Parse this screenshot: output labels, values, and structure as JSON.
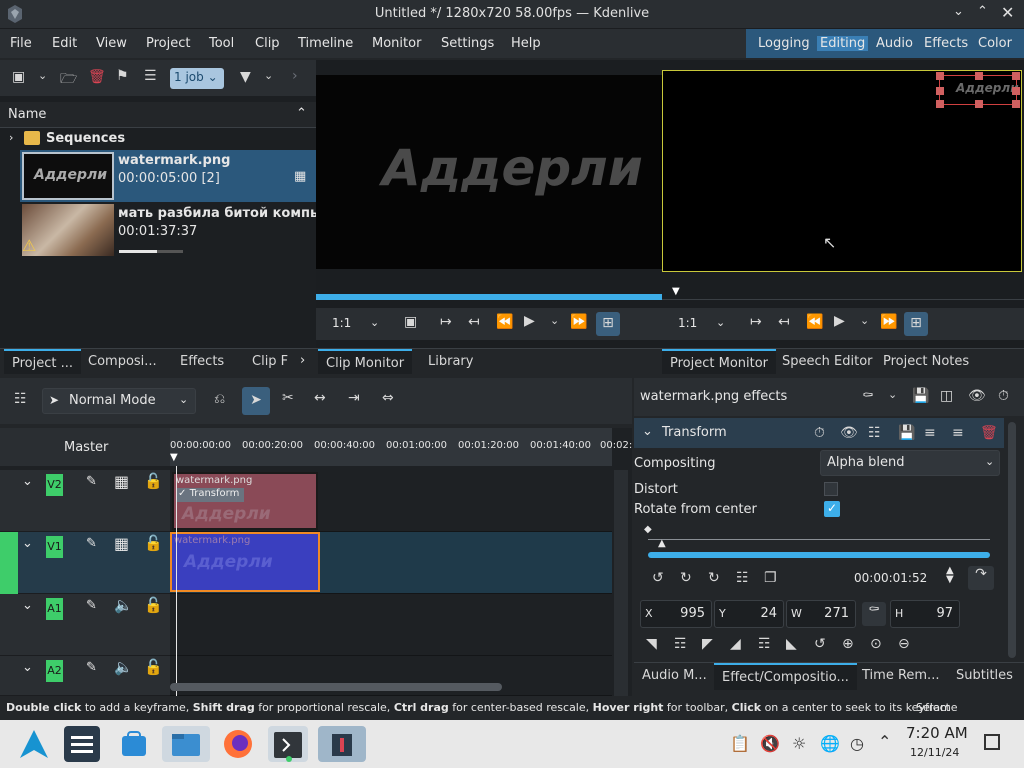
{
  "window": {
    "title": "Untitled */ 1280x720 58.00fps — Kdenlive"
  },
  "menu": {
    "items": [
      "File",
      "Edit",
      "View",
      "Project",
      "Tool",
      "Clip",
      "Timeline",
      "Monitor",
      "Settings",
      "Help"
    ]
  },
  "layouts": {
    "items": [
      "Logging",
      "Editing",
      "Audio",
      "Effects",
      "Color"
    ],
    "active": "Editing"
  },
  "bin": {
    "job_label": "1 job",
    "name_header": "Name",
    "folder": "Sequences",
    "items": [
      {
        "name": "watermark.png",
        "meta": "00:00:05:00 [2]"
      },
      {
        "name": "мать разбила битой компьют",
        "meta": "00:01:37:37",
        "progress": 0.6
      }
    ],
    "tabs": [
      "Project ...",
      "Composi...",
      "Effects",
      "Clip F"
    ]
  },
  "clip_monitor": {
    "preview_text": "Аддерли",
    "zoom": "1:1",
    "tabs": [
      "Clip Monitor",
      "Library"
    ]
  },
  "project_monitor": {
    "preview_text": "Аддерли",
    "zoom": "1:1",
    "tabs": [
      "Project Monitor",
      "Speech Editor",
      "Project Notes"
    ]
  },
  "timeline": {
    "mode": "Normal Mode",
    "master_label": "Master",
    "ruler": [
      "00:00:00:00",
      "00:00:20:00",
      "00:00:40:00",
      "00:01:00:00",
      "00:01:20:00",
      "00:01:40:00",
      "00:02:"
    ],
    "tracks": [
      {
        "name": "V2",
        "kind": "video"
      },
      {
        "name": "V1",
        "kind": "video"
      },
      {
        "name": "A1",
        "kind": "audio"
      },
      {
        "name": "A2",
        "kind": "audio"
      }
    ],
    "clip_v2": {
      "label": "watermark.png",
      "effect": "Transform",
      "watermark": "Аддерли"
    },
    "clip_v1": {
      "label": "watermark.png",
      "watermark": "Аддерли"
    }
  },
  "effects_panel": {
    "title": "watermark.png effects",
    "effect_name": "Transform",
    "compositing_label": "Compositing",
    "compositing_value": "Alpha blend",
    "distort_label": "Distort",
    "distort_checked": false,
    "rotate_label": "Rotate from center",
    "rotate_checked": true,
    "timecode": "00:00:01:52",
    "x_label": "X",
    "x_value": "995",
    "y_label": "Y",
    "y_value": "24",
    "w_label": "W",
    "w_value": "271",
    "h_label": "H",
    "h_value": "97",
    "tabs": [
      "Audio M...",
      "Effect/Compositio...",
      "Time Rem...",
      "Subtitles"
    ]
  },
  "status": {
    "parts": [
      {
        "b": "Double click",
        "t": " to add a keyframe, "
      },
      {
        "b": "Shift drag",
        "t": " for proportional rescale, "
      },
      {
        "b": "Ctrl drag",
        "t": " for center-based rescale, "
      },
      {
        "b": "Hover right",
        "t": " for toolbar, "
      },
      {
        "b": "Click",
        "t": " on a center to seek to its keyframe"
      }
    ],
    "right": "Select"
  },
  "taskbar": {
    "time": "7:20 AM",
    "date": "12/11/24"
  },
  "colors": {
    "accent": "#3daee9",
    "track_label": "#3ecd6a",
    "clip_v2": "#8a4a57",
    "clip_v1": "#3a3fbf",
    "selection_border": "#f08a24"
  }
}
